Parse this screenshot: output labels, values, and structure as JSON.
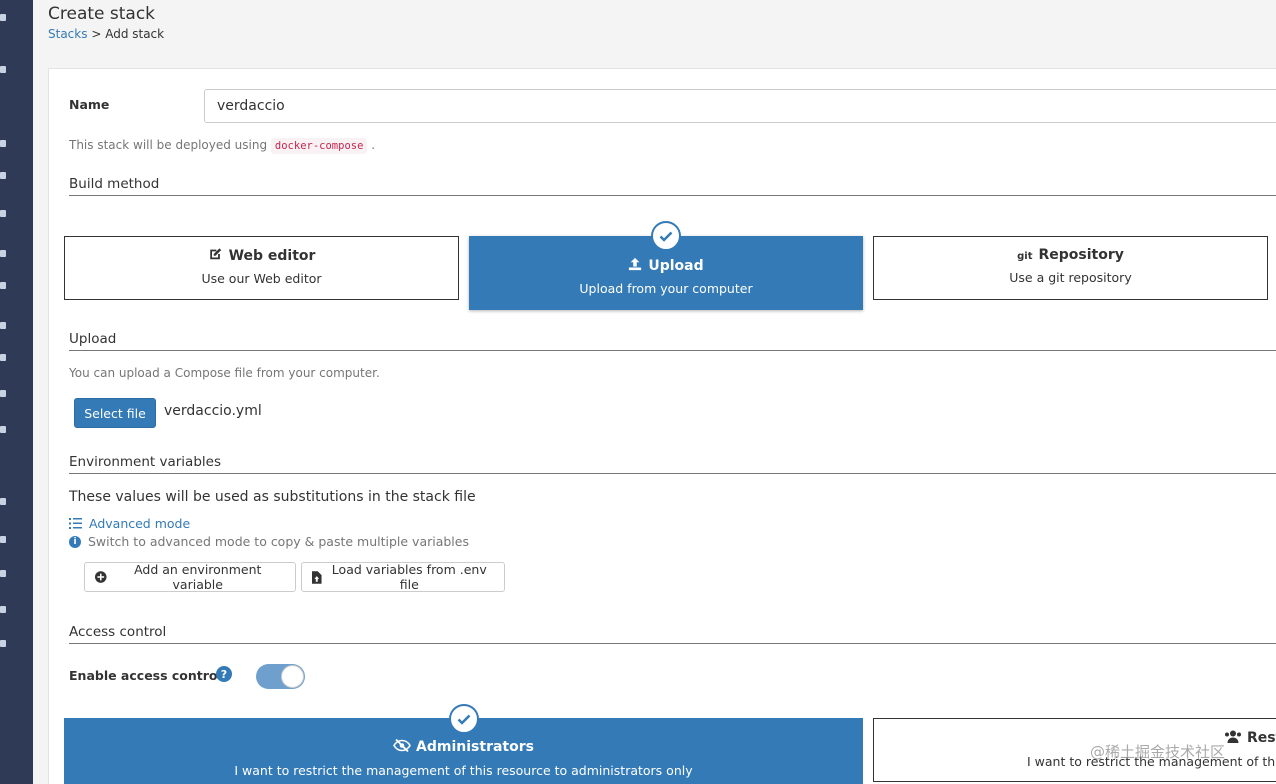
{
  "header": {
    "title": "Create stack",
    "breadcrumb_link": "Stacks",
    "breadcrumb_sep": ">",
    "breadcrumb_current": "Add stack"
  },
  "form": {
    "name_label": "Name",
    "name_value": "verdaccio",
    "deploy_hint_prefix": "This stack will be deployed using",
    "deploy_hint_code": "docker-compose",
    "deploy_hint_suffix": "."
  },
  "build_method": {
    "section_title": "Build method",
    "options": [
      {
        "title": "Web editor",
        "subtitle": "Use our Web editor",
        "icon": "edit-icon",
        "selected": false
      },
      {
        "title": "Upload",
        "subtitle": "Upload from your computer",
        "icon": "upload-icon",
        "selected": true
      },
      {
        "title": "Repository",
        "subtitle": "Use a git repository",
        "icon": "git-icon",
        "icon_text": "git",
        "selected": false
      }
    ]
  },
  "upload": {
    "section_title": "Upload",
    "hint": "You can upload a Compose file from your computer.",
    "select_button": "Select file",
    "file_name": "verdaccio.yml"
  },
  "env": {
    "section_title": "Environment variables",
    "description": "These values will be used as substitutions in the stack file",
    "advanced_mode": "Advanced mode",
    "advanced_hint": "Switch to advanced mode to copy & paste multiple variables",
    "add_button": "Add an environment variable",
    "load_button": "Load variables from .env file"
  },
  "access": {
    "section_title": "Access control",
    "enable_label": "Enable access control",
    "enabled": true,
    "options": [
      {
        "title": "Administrators",
        "subtitle": "I want to restrict the management of this resource to administrators only",
        "selected": true
      },
      {
        "title": "Rest",
        "subtitle": "I want to restrict the management of this",
        "selected": false
      }
    ]
  },
  "watermark": "@稀土掘金技术社区",
  "colors": {
    "accent": "#337ab7",
    "sidebar": "#2f3b56",
    "code_text": "#c7254e"
  }
}
